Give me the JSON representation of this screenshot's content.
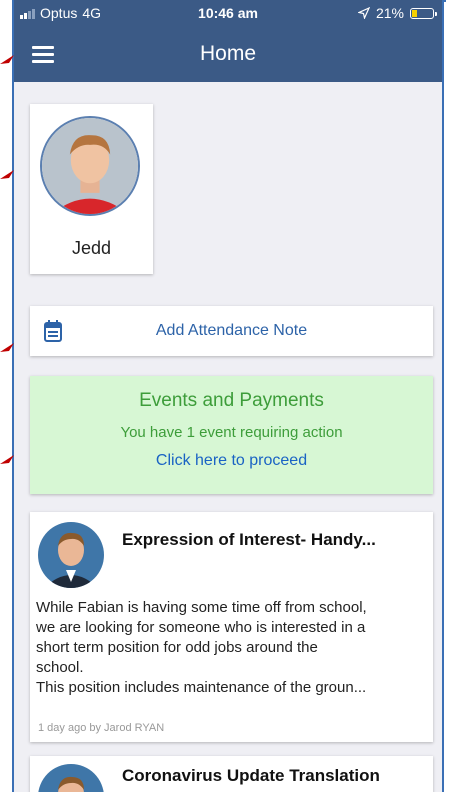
{
  "status_bar": {
    "carrier": "Optus",
    "network": "4G",
    "time": "10:46 am",
    "battery": "21%",
    "battery_level": 0.21
  },
  "header": {
    "title": "Home"
  },
  "student": {
    "name": "Jedd"
  },
  "attendance": {
    "label": "Add Attendance Note"
  },
  "events": {
    "title": "Events and Payments",
    "subtitle": "You have 1 event requiring action",
    "link": "Click here to proceed"
  },
  "news": [
    {
      "title": "Expression of Interest- Handy...",
      "body_lines": [
        "While Fabian is having some time off from school,",
        "we are looking for someone who is interested in a",
        "short term position for odd jobs around the",
        "school.",
        "This position includes maintenance of the groun..."
      ],
      "meta": "1 day ago by Jarod RYAN"
    },
    {
      "title": "Coronavirus Update Translation"
    }
  ],
  "colors": {
    "header": "#3b5a86",
    "link": "#2d63a8",
    "events_bg": "#d7f7d4",
    "events_text": "#3d9d3a",
    "annotation_arrow": "#c00000"
  }
}
